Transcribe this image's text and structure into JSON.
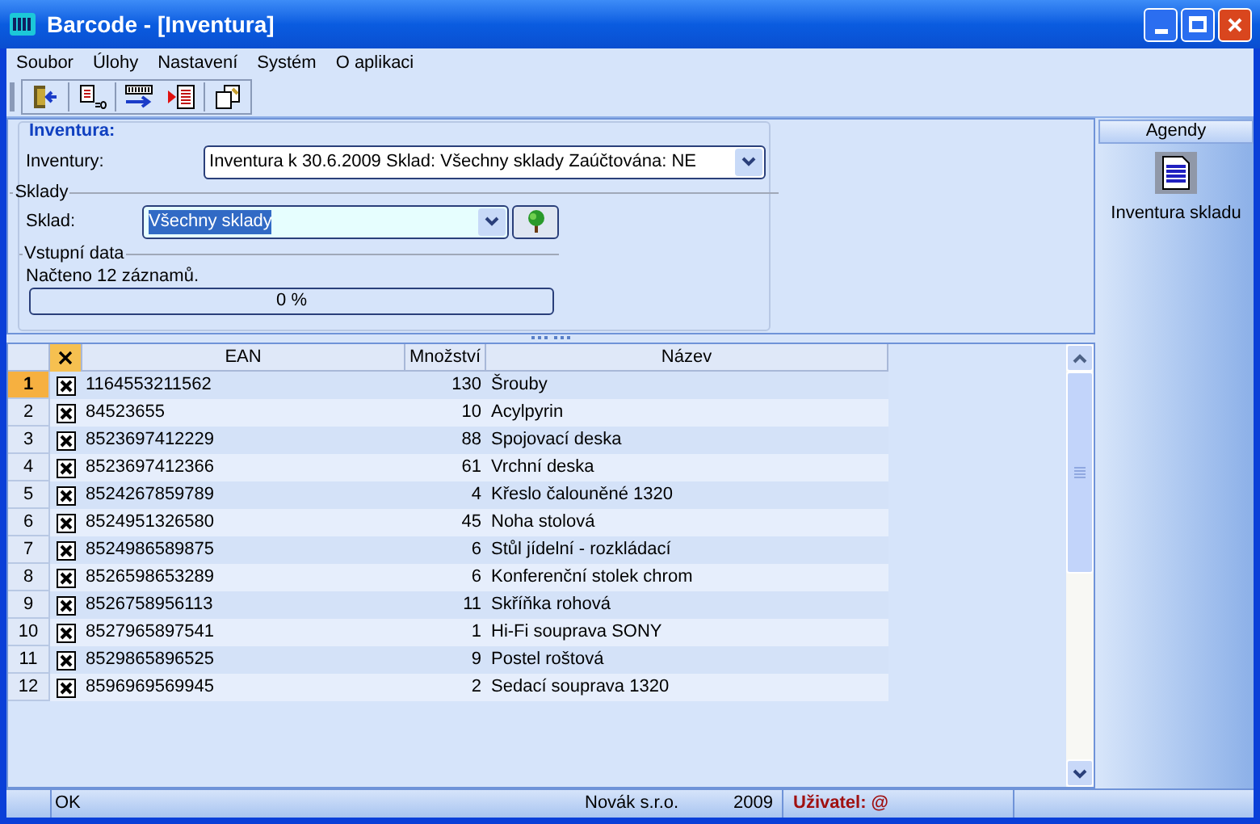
{
  "window": {
    "title": "Barcode - [Inventura]"
  },
  "menu": [
    "Soubor",
    "Úlohy",
    "Nastavení",
    "Systém",
    "O aplikaci"
  ],
  "inventura": {
    "heading": "Inventura:",
    "label": "Inventury:",
    "value": "Inventura k 30.6.2009  Sklad: Všechny sklady  Zaúčtována: NE"
  },
  "sklady": {
    "heading": "Sklady",
    "label": "Sklad:",
    "value": "Všechny sklady"
  },
  "vstupni_data": {
    "heading": "Vstupní data",
    "message": "Načteno 12 záznamů.",
    "progress": {
      "level": 0,
      "reading": "0 %"
    }
  },
  "table": {
    "columns": [
      "EAN",
      "Množství",
      "Název"
    ],
    "rows": [
      {
        "number": "1",
        "checked": true,
        "selected": true,
        "ean": "1164553211562",
        "qty": "130",
        "name": "Šrouby"
      },
      {
        "number": "2",
        "checked": true,
        "selected": false,
        "ean": "84523655",
        "qty": "10",
        "name": "Acylpyrin"
      },
      {
        "number": "3",
        "checked": true,
        "selected": false,
        "ean": "8523697412229",
        "qty": "88",
        "name": "Spojovací deska"
      },
      {
        "number": "4",
        "checked": true,
        "selected": false,
        "ean": "8523697412366",
        "qty": "61",
        "name": "Vrchní deska"
      },
      {
        "number": "5",
        "checked": true,
        "selected": false,
        "ean": "8524267859789",
        "qty": "4",
        "name": "Křeslo čalouněné 1320"
      },
      {
        "number": "6",
        "checked": true,
        "selected": false,
        "ean": "8524951326580",
        "qty": "45",
        "name": "Noha stolová"
      },
      {
        "number": "7",
        "checked": true,
        "selected": false,
        "ean": "8524986589875",
        "qty": "6",
        "name": "Stůl jídelní - rozkládací"
      },
      {
        "number": "8",
        "checked": true,
        "selected": false,
        "ean": "8526598653289",
        "qty": "6",
        "name": "Konferenční stolek chrom"
      },
      {
        "number": "9",
        "checked": true,
        "selected": false,
        "ean": "8526758956113",
        "qty": "11",
        "name": "Skříňka rohová"
      },
      {
        "number": "10",
        "checked": true,
        "selected": false,
        "ean": "8527965897541",
        "qty": "1",
        "name": "Hi-Fi souprava SONY"
      },
      {
        "number": "11",
        "checked": true,
        "selected": false,
        "ean": "8529865896525",
        "qty": "9",
        "name": "Postel roštová"
      },
      {
        "number": "12",
        "checked": true,
        "selected": false,
        "ean": "8596969569945",
        "qty": "2",
        "name": "Sedací souprava 1320"
      }
    ]
  },
  "agendy": {
    "title": "Agendy",
    "items": [
      "Inventura skladu"
    ]
  },
  "status_bar": {
    "status": "OK",
    "company": "Novák s.r.o.",
    "year": "2009",
    "user": "Uživatel: @"
  }
}
